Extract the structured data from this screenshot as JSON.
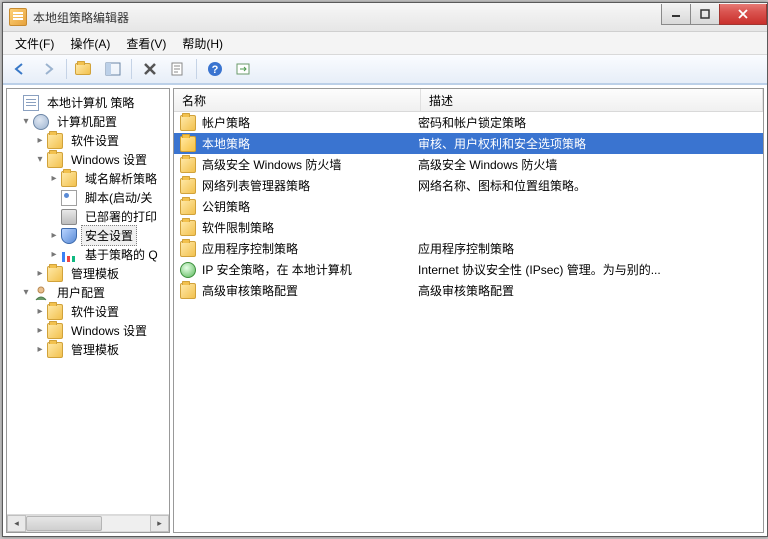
{
  "window": {
    "title": "本地组策略编辑器"
  },
  "menu": {
    "file": "文件(F)",
    "action": "操作(A)",
    "view": "查看(V)",
    "help": "帮助(H)"
  },
  "tree": {
    "root": "本地计算机 策略",
    "computer_config": "计算机配置",
    "software_settings": "软件设置",
    "windows_settings": "Windows 设置",
    "name_resolution": "域名解析策略",
    "scripts": "脚本(启动/关",
    "deployed_printers": "已部署的打印",
    "security_settings": "安全设置",
    "policy_qos": "基于策略的 Q",
    "admin_templates": "管理模板",
    "user_config": "用户配置",
    "user_software_settings": "软件设置",
    "user_windows_settings": "Windows 设置",
    "user_admin_templates": "管理模板"
  },
  "list": {
    "columns": {
      "name": "名称",
      "description": "描述"
    },
    "rows": [
      {
        "name": "帐户策略",
        "desc": "密码和帐户锁定策略"
      },
      {
        "name": "本地策略",
        "desc": "审核、用户权利和安全选项策略",
        "selected": true
      },
      {
        "name": "高级安全 Windows 防火墙",
        "desc": "高级安全 Windows 防火墙"
      },
      {
        "name": "网络列表管理器策略",
        "desc": "网络名称、图标和位置组策略。"
      },
      {
        "name": "公钥策略",
        "desc": ""
      },
      {
        "name": "软件限制策略",
        "desc": ""
      },
      {
        "name": "应用程序控制策略",
        "desc": "应用程序控制策略"
      },
      {
        "name": "IP 安全策略，在 本地计算机",
        "desc": "Internet 协议安全性 (IPsec) 管理。为与别的..."
      },
      {
        "name": "高级审核策略配置",
        "desc": "高级审核策略配置"
      }
    ]
  }
}
